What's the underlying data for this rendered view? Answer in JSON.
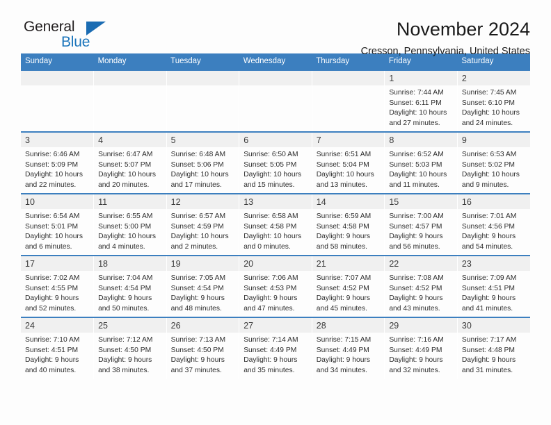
{
  "brand": {
    "name_part1": "General",
    "name_part2": "Blue",
    "triangle_color": "#1b6cb3",
    "blue_text_color": "#1b75bb"
  },
  "header": {
    "title": "November 2024",
    "subtitle": "Cresson, Pennsylvania, United States"
  },
  "theme": {
    "header_bg": "#3c7fbf",
    "daynum_bg": "#f0f0f0",
    "page_bg": "#fdfdfd",
    "text_color": "#2d2d2d"
  },
  "columns": [
    "Sunday",
    "Monday",
    "Tuesday",
    "Wednesday",
    "Thursday",
    "Friday",
    "Saturday"
  ],
  "weeks": [
    [
      {
        "day": "",
        "empty": true
      },
      {
        "day": "",
        "empty": true
      },
      {
        "day": "",
        "empty": true
      },
      {
        "day": "",
        "empty": true
      },
      {
        "day": "",
        "empty": true
      },
      {
        "day": "1",
        "sunrise": "Sunrise: 7:44 AM",
        "sunset": "Sunset: 6:11 PM",
        "daylight1": "Daylight: 10 hours",
        "daylight2": "and 27 minutes."
      },
      {
        "day": "2",
        "sunrise": "Sunrise: 7:45 AM",
        "sunset": "Sunset: 6:10 PM",
        "daylight1": "Daylight: 10 hours",
        "daylight2": "and 24 minutes."
      }
    ],
    [
      {
        "day": "3",
        "sunrise": "Sunrise: 6:46 AM",
        "sunset": "Sunset: 5:09 PM",
        "daylight1": "Daylight: 10 hours",
        "daylight2": "and 22 minutes."
      },
      {
        "day": "4",
        "sunrise": "Sunrise: 6:47 AM",
        "sunset": "Sunset: 5:07 PM",
        "daylight1": "Daylight: 10 hours",
        "daylight2": "and 20 minutes."
      },
      {
        "day": "5",
        "sunrise": "Sunrise: 6:48 AM",
        "sunset": "Sunset: 5:06 PM",
        "daylight1": "Daylight: 10 hours",
        "daylight2": "and 17 minutes."
      },
      {
        "day": "6",
        "sunrise": "Sunrise: 6:50 AM",
        "sunset": "Sunset: 5:05 PM",
        "daylight1": "Daylight: 10 hours",
        "daylight2": "and 15 minutes."
      },
      {
        "day": "7",
        "sunrise": "Sunrise: 6:51 AM",
        "sunset": "Sunset: 5:04 PM",
        "daylight1": "Daylight: 10 hours",
        "daylight2": "and 13 minutes."
      },
      {
        "day": "8",
        "sunrise": "Sunrise: 6:52 AM",
        "sunset": "Sunset: 5:03 PM",
        "daylight1": "Daylight: 10 hours",
        "daylight2": "and 11 minutes."
      },
      {
        "day": "9",
        "sunrise": "Sunrise: 6:53 AM",
        "sunset": "Sunset: 5:02 PM",
        "daylight1": "Daylight: 10 hours",
        "daylight2": "and 9 minutes."
      }
    ],
    [
      {
        "day": "10",
        "sunrise": "Sunrise: 6:54 AM",
        "sunset": "Sunset: 5:01 PM",
        "daylight1": "Daylight: 10 hours",
        "daylight2": "and 6 minutes."
      },
      {
        "day": "11",
        "sunrise": "Sunrise: 6:55 AM",
        "sunset": "Sunset: 5:00 PM",
        "daylight1": "Daylight: 10 hours",
        "daylight2": "and 4 minutes."
      },
      {
        "day": "12",
        "sunrise": "Sunrise: 6:57 AM",
        "sunset": "Sunset: 4:59 PM",
        "daylight1": "Daylight: 10 hours",
        "daylight2": "and 2 minutes."
      },
      {
        "day": "13",
        "sunrise": "Sunrise: 6:58 AM",
        "sunset": "Sunset: 4:58 PM",
        "daylight1": "Daylight: 10 hours",
        "daylight2": "and 0 minutes."
      },
      {
        "day": "14",
        "sunrise": "Sunrise: 6:59 AM",
        "sunset": "Sunset: 4:58 PM",
        "daylight1": "Daylight: 9 hours",
        "daylight2": "and 58 minutes."
      },
      {
        "day": "15",
        "sunrise": "Sunrise: 7:00 AM",
        "sunset": "Sunset: 4:57 PM",
        "daylight1": "Daylight: 9 hours",
        "daylight2": "and 56 minutes."
      },
      {
        "day": "16",
        "sunrise": "Sunrise: 7:01 AM",
        "sunset": "Sunset: 4:56 PM",
        "daylight1": "Daylight: 9 hours",
        "daylight2": "and 54 minutes."
      }
    ],
    [
      {
        "day": "17",
        "sunrise": "Sunrise: 7:02 AM",
        "sunset": "Sunset: 4:55 PM",
        "daylight1": "Daylight: 9 hours",
        "daylight2": "and 52 minutes."
      },
      {
        "day": "18",
        "sunrise": "Sunrise: 7:04 AM",
        "sunset": "Sunset: 4:54 PM",
        "daylight1": "Daylight: 9 hours",
        "daylight2": "and 50 minutes."
      },
      {
        "day": "19",
        "sunrise": "Sunrise: 7:05 AM",
        "sunset": "Sunset: 4:54 PM",
        "daylight1": "Daylight: 9 hours",
        "daylight2": "and 48 minutes."
      },
      {
        "day": "20",
        "sunrise": "Sunrise: 7:06 AM",
        "sunset": "Sunset: 4:53 PM",
        "daylight1": "Daylight: 9 hours",
        "daylight2": "and 47 minutes."
      },
      {
        "day": "21",
        "sunrise": "Sunrise: 7:07 AM",
        "sunset": "Sunset: 4:52 PM",
        "daylight1": "Daylight: 9 hours",
        "daylight2": "and 45 minutes."
      },
      {
        "day": "22",
        "sunrise": "Sunrise: 7:08 AM",
        "sunset": "Sunset: 4:52 PM",
        "daylight1": "Daylight: 9 hours",
        "daylight2": "and 43 minutes."
      },
      {
        "day": "23",
        "sunrise": "Sunrise: 7:09 AM",
        "sunset": "Sunset: 4:51 PM",
        "daylight1": "Daylight: 9 hours",
        "daylight2": "and 41 minutes."
      }
    ],
    [
      {
        "day": "24",
        "sunrise": "Sunrise: 7:10 AM",
        "sunset": "Sunset: 4:51 PM",
        "daylight1": "Daylight: 9 hours",
        "daylight2": "and 40 minutes."
      },
      {
        "day": "25",
        "sunrise": "Sunrise: 7:12 AM",
        "sunset": "Sunset: 4:50 PM",
        "daylight1": "Daylight: 9 hours",
        "daylight2": "and 38 minutes."
      },
      {
        "day": "26",
        "sunrise": "Sunrise: 7:13 AM",
        "sunset": "Sunset: 4:50 PM",
        "daylight1": "Daylight: 9 hours",
        "daylight2": "and 37 minutes."
      },
      {
        "day": "27",
        "sunrise": "Sunrise: 7:14 AM",
        "sunset": "Sunset: 4:49 PM",
        "daylight1": "Daylight: 9 hours",
        "daylight2": "and 35 minutes."
      },
      {
        "day": "28",
        "sunrise": "Sunrise: 7:15 AM",
        "sunset": "Sunset: 4:49 PM",
        "daylight1": "Daylight: 9 hours",
        "daylight2": "and 34 minutes."
      },
      {
        "day": "29",
        "sunrise": "Sunrise: 7:16 AM",
        "sunset": "Sunset: 4:49 PM",
        "daylight1": "Daylight: 9 hours",
        "daylight2": "and 32 minutes."
      },
      {
        "day": "30",
        "sunrise": "Sunrise: 7:17 AM",
        "sunset": "Sunset: 4:48 PM",
        "daylight1": "Daylight: 9 hours",
        "daylight2": "and 31 minutes."
      }
    ]
  ]
}
